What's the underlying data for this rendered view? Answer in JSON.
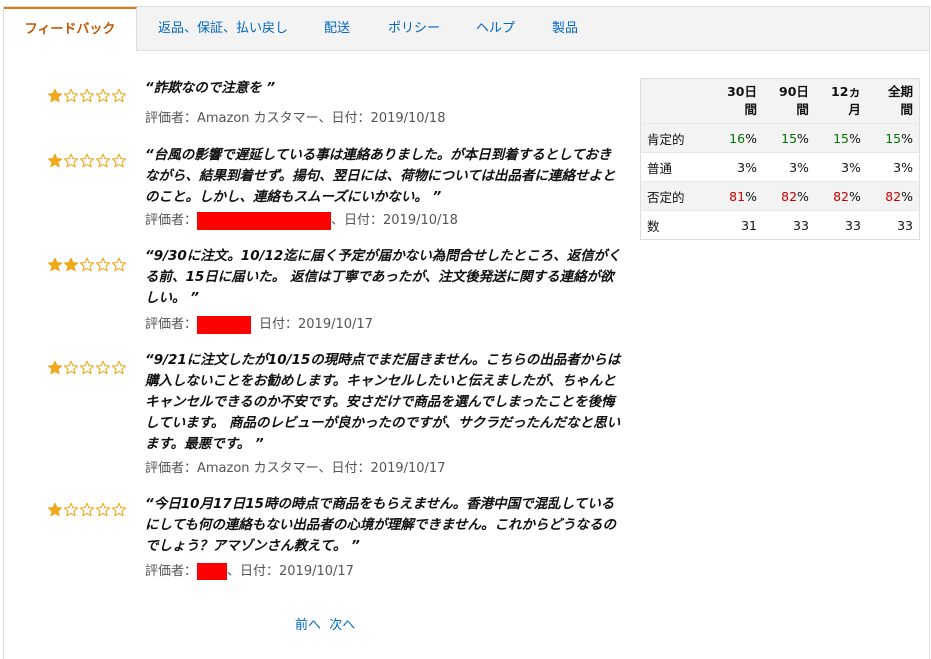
{
  "tabs": [
    {
      "label": "フィードバック",
      "active": true
    },
    {
      "label": "返品、保証、払い戻し"
    },
    {
      "label": "配送"
    },
    {
      "label": "ポリシー"
    },
    {
      "label": "ヘルプ"
    },
    {
      "label": "製品"
    }
  ],
  "reviews": [
    {
      "stars": 1,
      "text": "“詐欺なので注意を ”",
      "meta_prefix": "評価者：Amazon カスタマー、日付：2019/10/18",
      "meta_suffix": ""
    },
    {
      "stars": 1,
      "text": "“台風の影響で遅延している事は連絡ありました。が本日到着するとしておきながら、結果到着せず。揚句、翌日には、荷物については出品者に連絡せよとのこと。しかし、連絡もスムーズにいかない。 ”",
      "meta_prefix": "評価者：",
      "meta_suffix": "、日付：2019/10/18"
    },
    {
      "stars": 2,
      "text": "“9/30に注文。10/12迄に届く予定が届かない為問合せしたところ、返信がくる前、15日に届いた。 返信は丁寧であったが、注文後発送に関する連絡が欲しい。 ”",
      "meta_prefix": "評価者：",
      "meta_suffix": "日付：2019/10/17"
    },
    {
      "stars": 1,
      "text": "“9/21に注文したが10/15の現時点でまだ届きません。こちらの出品者からは購入しないことをお勧めします。キャンセルしたいと伝えましたが、ちゃんとキャンセルできるのか不安です。安さだけで商品を選んでしまったことを後悔しています。 商品のレビューが良かったのですが、サクラだったんだなと思います。最悪です。 ”",
      "meta_prefix": "評価者：Amazon カスタマー、日付：2019/10/17",
      "meta_suffix": ""
    },
    {
      "stars": 1,
      "text": "“今日10月17日15時の時点で商品をもらえません。香港中国で混乱しているにしても何の連絡もない出品者の心境が理解できません。これからどうなるのでしょう？アマゾンさん教えて。 ”",
      "meta_prefix": "評価者：",
      "meta_suffix": "、日付：2019/10/17"
    }
  ],
  "pager": {
    "prev": "前へ",
    "next": "次へ"
  },
  "stats": {
    "headers": [
      "30日間",
      "90日間",
      "12ヵ月",
      "全期間"
    ],
    "rows": [
      {
        "label": "肯定的",
        "values": [
          "16",
          "15",
          "15",
          "15"
        ],
        "unit": "%"
      },
      {
        "label": "普通",
        "values": [
          "3%",
          "3%",
          "3%",
          "3%"
        ],
        "unit": ""
      },
      {
        "label": "否定的",
        "values": [
          "81",
          "82",
          "82",
          "82"
        ],
        "unit": "%"
      },
      {
        "label": "数",
        "values": [
          "31",
          "33",
          "33",
          "33"
        ],
        "unit": ""
      }
    ]
  },
  "colors": {
    "star": "#f0a81c",
    "positive": "#007600",
    "negative": "#cc0000",
    "link": "#0066c0",
    "active_tab": "#c45500",
    "redaction": "#ff0000"
  }
}
